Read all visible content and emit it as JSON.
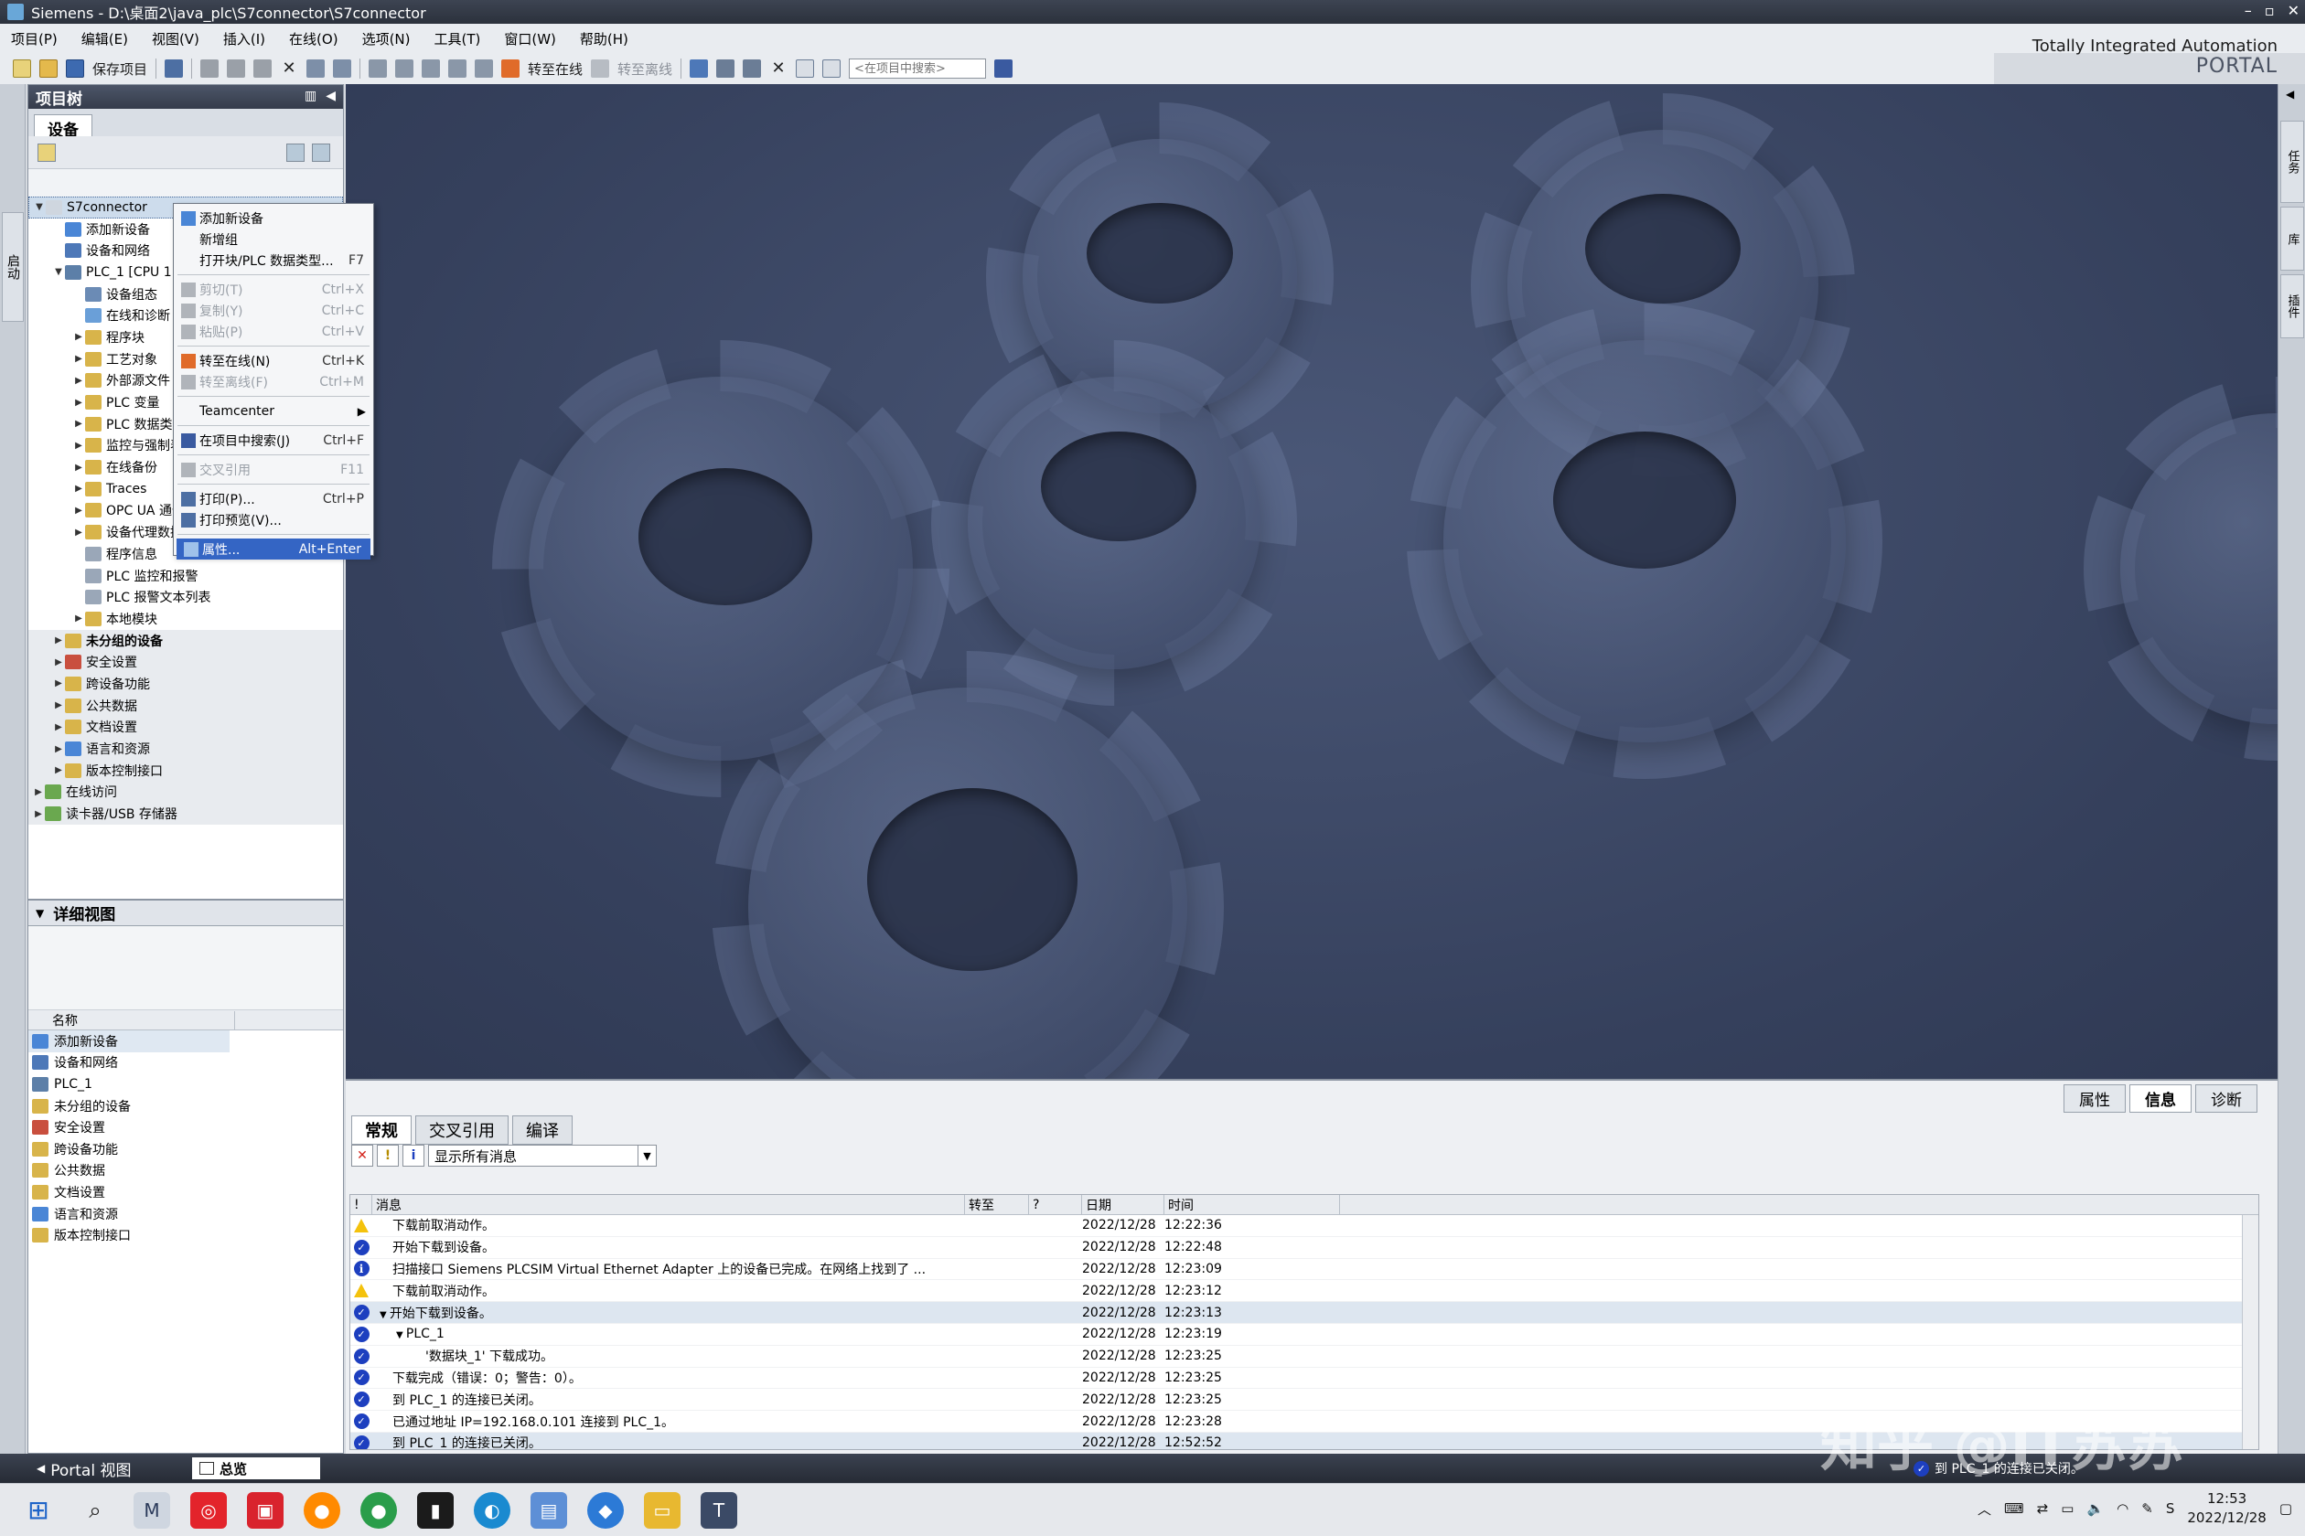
{
  "window": {
    "title": "Siemens  -  D:\\桌面2\\java_plc\\S7connector\\S7connector"
  },
  "brand": {
    "line1": "Totally Integrated Automation",
    "line2": "PORTAL"
  },
  "menu": [
    "项目(P)",
    "编辑(E)",
    "视图(V)",
    "插入(I)",
    "在线(O)",
    "选项(N)",
    "工具(T)",
    "窗口(W)",
    "帮助(H)"
  ],
  "toolbar": {
    "save_label": "保存项目",
    "go_online": "转至在线",
    "go_offline": "转至离线",
    "search_placeholder": "<在项目中搜索>"
  },
  "left_strip": {
    "label": "启动"
  },
  "project_tree": {
    "title": "项目树",
    "tab": "设备",
    "items": [
      {
        "label": "S7connector",
        "level": 0,
        "exp": "▼",
        "color": "#cfd6df",
        "selected": true
      },
      {
        "label": "添加新设备",
        "level": 1,
        "exp": "",
        "color": "#4a86d6"
      },
      {
        "label": "设备和网络",
        "level": 1,
        "exp": "",
        "color": "#4d78b8"
      },
      {
        "label": "PLC_1 [CPU 1",
        "level": 1,
        "exp": "▼",
        "color": "#5c7fa8"
      },
      {
        "label": "设备组态",
        "level": 2,
        "exp": "",
        "color": "#6b8bb5"
      },
      {
        "label": "在线和诊断",
        "level": 2,
        "exp": "",
        "color": "#6a9fd8"
      },
      {
        "label": "程序块",
        "level": 2,
        "exp": "▶",
        "color": "#d8b44a"
      },
      {
        "label": "工艺对象",
        "level": 2,
        "exp": "▶",
        "color": "#d8b44a"
      },
      {
        "label": "外部源文件",
        "level": 2,
        "exp": "▶",
        "color": "#d8b44a"
      },
      {
        "label": "PLC 变量",
        "level": 2,
        "exp": "▶",
        "color": "#d8b44a"
      },
      {
        "label": "PLC 数据类型",
        "level": 2,
        "exp": "▶",
        "color": "#d8b44a"
      },
      {
        "label": "监控与强制表",
        "level": 2,
        "exp": "▶",
        "color": "#d8b44a"
      },
      {
        "label": "在线备份",
        "level": 2,
        "exp": "▶",
        "color": "#d8b44a"
      },
      {
        "label": "Traces",
        "level": 2,
        "exp": "▶",
        "color": "#d8b44a"
      },
      {
        "label": "OPC UA 通信",
        "level": 2,
        "exp": "▶",
        "color": "#d8b44a"
      },
      {
        "label": "设备代理数据",
        "level": 2,
        "exp": "▶",
        "color": "#d8b44a"
      },
      {
        "label": "程序信息",
        "level": 2,
        "exp": "",
        "color": "#9aa7b8"
      },
      {
        "label": "PLC 监控和报警",
        "level": 2,
        "exp": "",
        "color": "#9aa7b8"
      },
      {
        "label": "PLC 报警文本列表",
        "level": 2,
        "exp": "",
        "color": "#9aa7b8"
      },
      {
        "label": "本地模块",
        "level": 2,
        "exp": "▶",
        "color": "#d8b44a"
      },
      {
        "label": "未分组的设备",
        "level": 1,
        "exp": "▶",
        "color": "#d8b44a",
        "bold": true,
        "shaded": true
      },
      {
        "label": "安全设置",
        "level": 1,
        "exp": "▶",
        "color": "#c94f3e",
        "shaded": true
      },
      {
        "label": "跨设备功能",
        "level": 1,
        "exp": "▶",
        "color": "#d8b44a",
        "shaded": true
      },
      {
        "label": "公共数据",
        "level": 1,
        "exp": "▶",
        "color": "#d8b44a",
        "shaded": true
      },
      {
        "label": "文档设置",
        "level": 1,
        "exp": "▶",
        "color": "#d8b44a",
        "shaded": true
      },
      {
        "label": "语言和资源",
        "level": 1,
        "exp": "▶",
        "color": "#4a86d6",
        "shaded": true
      },
      {
        "label": "版本控制接口",
        "level": 1,
        "exp": "▶",
        "color": "#d8b44a",
        "shaded": true
      },
      {
        "label": "在线访问",
        "level": 0,
        "exp": "▶",
        "color": "#6aa84f",
        "shaded": true
      },
      {
        "label": "读卡器/USB 存储器",
        "level": 0,
        "exp": "▶",
        "color": "#6aa84f",
        "shaded": true
      }
    ]
  },
  "detail_view": {
    "title": "详细视图",
    "column": "名称",
    "items": [
      {
        "label": "添加新设备",
        "color": "#4a86d6"
      },
      {
        "label": "设备和网络",
        "color": "#4d78b8"
      },
      {
        "label": "PLC_1",
        "color": "#5c7fa8"
      },
      {
        "label": "未分组的设备",
        "color": "#d8b44a"
      },
      {
        "label": "安全设置",
        "color": "#c94f3e"
      },
      {
        "label": "跨设备功能",
        "color": "#d8b44a"
      },
      {
        "label": "公共数据",
        "color": "#d8b44a"
      },
      {
        "label": "文档设置",
        "color": "#d8b44a"
      },
      {
        "label": "语言和资源",
        "color": "#4a86d6"
      },
      {
        "label": "版本控制接口",
        "color": "#d8b44a"
      }
    ]
  },
  "context_menu": {
    "items": [
      {
        "label": "添加新设备",
        "shortcut": "",
        "icon": "#4a86d6"
      },
      {
        "label": "新增组",
        "shortcut": ""
      },
      {
        "label": "打开块/PLC 数据类型...",
        "shortcut": "F7"
      },
      {
        "sep": true
      },
      {
        "label": "剪切(T)",
        "shortcut": "Ctrl+X",
        "disabled": true,
        "icon": "#b0b4ba"
      },
      {
        "label": "复制(Y)",
        "shortcut": "Ctrl+C",
        "disabled": true,
        "icon": "#b0b4ba"
      },
      {
        "label": "粘贴(P)",
        "shortcut": "Ctrl+V",
        "disabled": true,
        "icon": "#b0b4ba"
      },
      {
        "sep": true
      },
      {
        "label": "转至在线(N)",
        "shortcut": "Ctrl+K",
        "icon": "#e06b2a"
      },
      {
        "label": "转至离线(F)",
        "shortcut": "Ctrl+M",
        "disabled": true,
        "icon": "#b0b4ba"
      },
      {
        "sep": true
      },
      {
        "label": "Teamcenter",
        "shortcut": "",
        "submenu": true
      },
      {
        "sep": true
      },
      {
        "label": "在项目中搜索(J)",
        "shortcut": "Ctrl+F",
        "icon": "#3a5aa0"
      },
      {
        "sep": true
      },
      {
        "label": "交叉引用",
        "shortcut": "F11",
        "disabled": true,
        "icon": "#b0b4ba"
      },
      {
        "sep": true
      },
      {
        "label": "打印(P)...",
        "shortcut": "Ctrl+P",
        "icon": "#4d6fa3"
      },
      {
        "label": "打印预览(V)...",
        "shortcut": "",
        "icon": "#4d6fa3"
      },
      {
        "sep": true
      },
      {
        "label": "属性...",
        "shortcut": "Alt+Enter",
        "highlighted": true,
        "icon": "#9fc1ea"
      }
    ]
  },
  "inspector": {
    "tabs": [
      "属性",
      "信息",
      "诊断"
    ],
    "active_tab": "信息",
    "subtabs": [
      "常规",
      "交叉引用",
      "编译"
    ],
    "filter": "显示所有消息",
    "columns": {
      "msg": "消息",
      "goto": "转至",
      "q": "?",
      "date": "日期",
      "time": "时间"
    },
    "messages": [
      {
        "type": "warn",
        "text": "下载前取消动作。",
        "indent": 0,
        "date": "2022/12/28",
        "time": "12:22:36"
      },
      {
        "type": "ok",
        "text": "开始下载到设备。",
        "indent": 0,
        "date": "2022/12/28",
        "time": "12:22:48"
      },
      {
        "type": "info",
        "text": "扫描接口 Siemens PLCSIM Virtual Ethernet Adapter 上的设备已完成。在网络上找到了 ...",
        "indent": 0,
        "date": "2022/12/28",
        "time": "12:23:09"
      },
      {
        "type": "warn",
        "text": "下载前取消动作。",
        "indent": 0,
        "date": "2022/12/28",
        "time": "12:23:12"
      },
      {
        "type": "ok",
        "text": "开始下载到设备。",
        "indent": 0,
        "date": "2022/12/28",
        "time": "12:23:13",
        "expand": "▼",
        "sel": true
      },
      {
        "type": "ok",
        "text": "PLC_1",
        "indent": 1,
        "date": "2022/12/28",
        "time": "12:23:19",
        "expand": "▼"
      },
      {
        "type": "ok",
        "text": "'数据块_1' 下载成功。",
        "indent": 2,
        "date": "2022/12/28",
        "time": "12:23:25"
      },
      {
        "type": "ok",
        "text": "下载完成（错误：0；警告：0）。",
        "indent": 0,
        "date": "2022/12/28",
        "time": "12:23:25"
      },
      {
        "type": "ok",
        "text": "到 PLC_1 的连接已关闭。",
        "indent": 0,
        "date": "2022/12/28",
        "time": "12:23:25"
      },
      {
        "type": "ok",
        "text": "已通过地址 IP=192.168.0.101 连接到 PLC_1。",
        "indent": 0,
        "date": "2022/12/28",
        "time": "12:23:28"
      },
      {
        "type": "ok",
        "text": "到 PLC_1 的连接已关闭。",
        "indent": 0,
        "date": "2022/12/28",
        "time": "12:52:52",
        "sel": true
      }
    ]
  },
  "right_strip": {
    "tab1": "任务",
    "tab2": "库",
    "tab3": "插件"
  },
  "portal_bar": {
    "portal": "Portal 视图",
    "overview": "总览",
    "status": "到 PLC_1 的连接已关闭。"
  },
  "watermark": "知乎 @IT苏苏",
  "clock": {
    "time": "12:53",
    "date": "2022/12/28"
  }
}
